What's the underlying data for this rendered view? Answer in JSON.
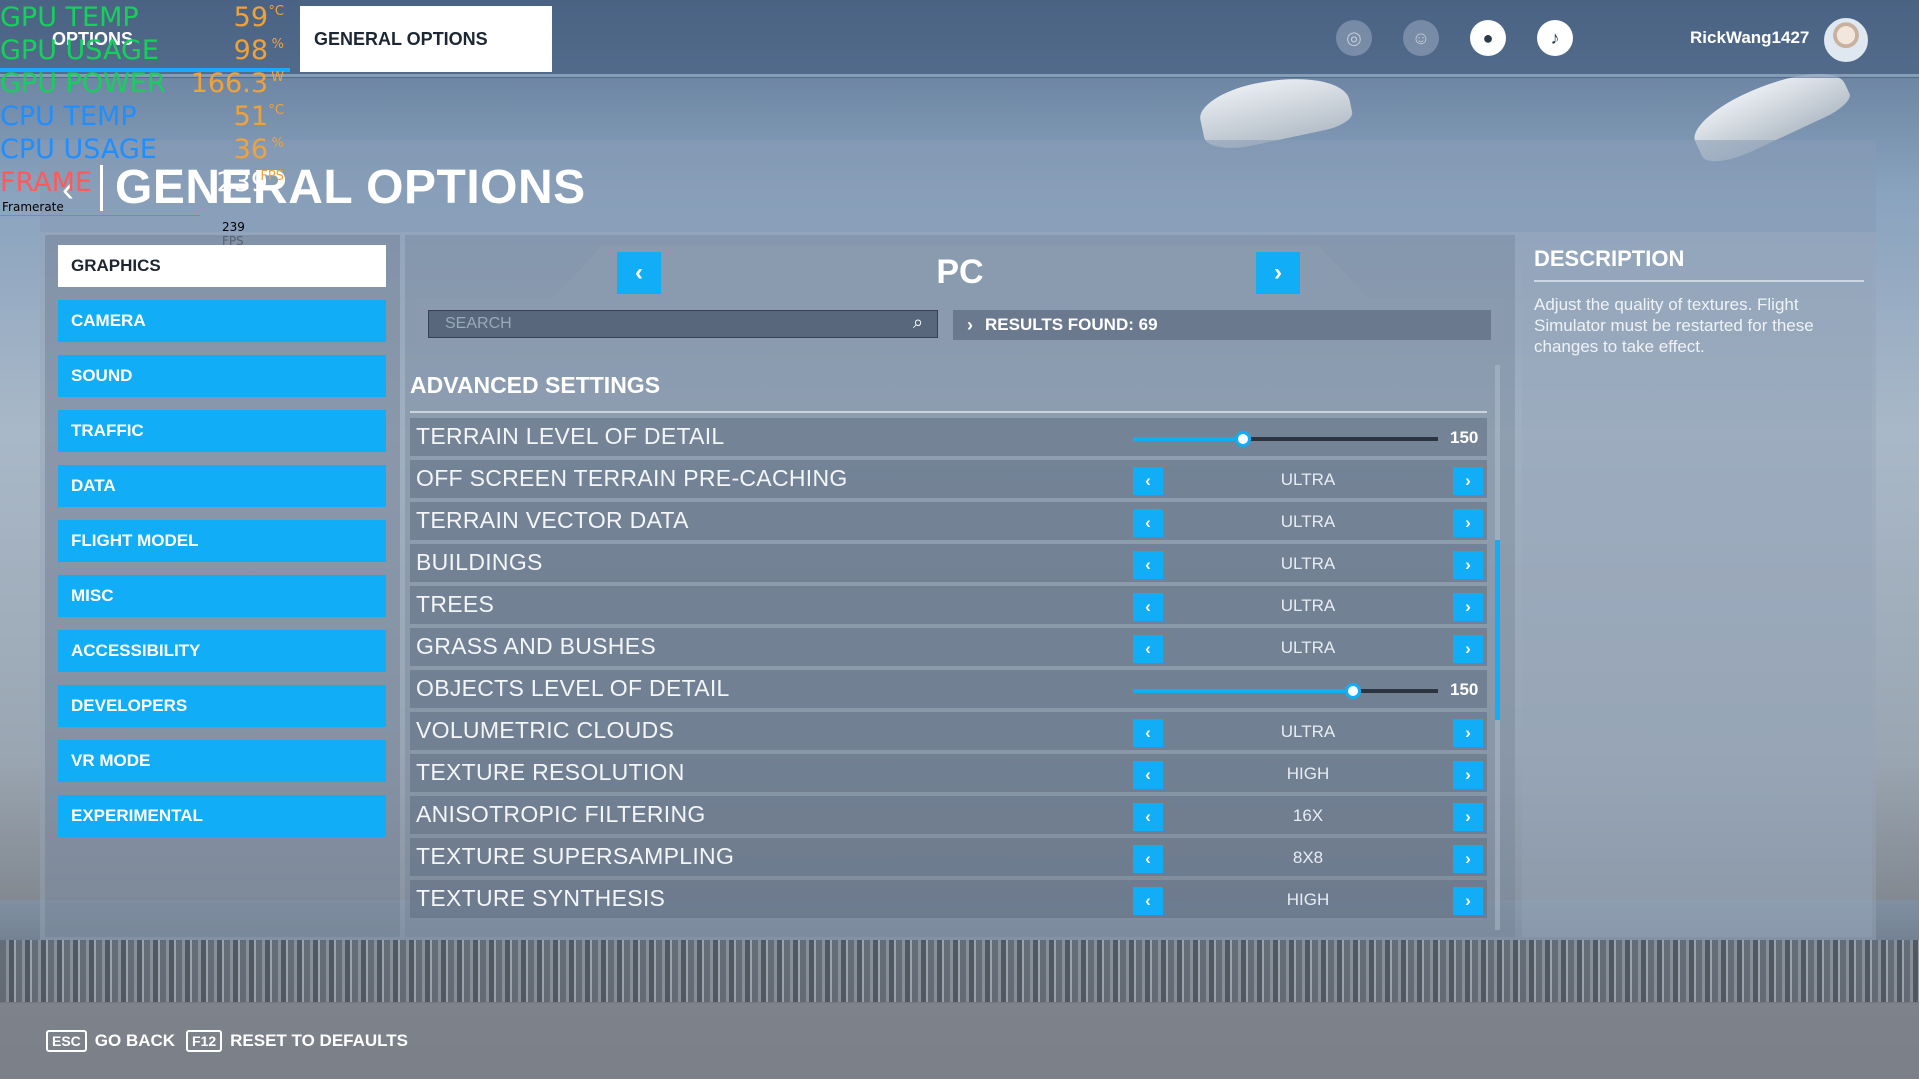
{
  "topbar": {
    "tabs": [
      {
        "label": "OPTIONS"
      },
      {
        "label": "GENERAL OPTIONS"
      }
    ],
    "username": "RickWang1427"
  },
  "hud": {
    "rows": [
      {
        "label": "GPU TEMP",
        "value": "59",
        "unit": "°C"
      },
      {
        "label": "GPU USAGE",
        "value": "98",
        "unit": "%"
      },
      {
        "label": "GPU POWER",
        "value": "166.3",
        "unit": "W"
      },
      {
        "label": "CPU TEMP",
        "value": "51",
        "unit": "°C"
      },
      {
        "label": "CPU USAGE",
        "value": "36",
        "unit": "%"
      },
      {
        "label": "FRAME",
        "value": "239",
        "unit": "FPS"
      }
    ],
    "graph_label": "Framerate",
    "graph_value": "239 FPS"
  },
  "page": {
    "title": "GENERAL OPTIONS"
  },
  "sidebar": {
    "items": [
      {
        "label": "GRAPHICS",
        "active": true
      },
      {
        "label": "CAMERA"
      },
      {
        "label": "SOUND"
      },
      {
        "label": "TRAFFIC"
      },
      {
        "label": "DATA"
      },
      {
        "label": "FLIGHT MODEL"
      },
      {
        "label": "MISC"
      },
      {
        "label": "ACCESSIBILITY"
      },
      {
        "label": "DEVELOPERS"
      },
      {
        "label": "VR MODE"
      },
      {
        "label": "EXPERIMENTAL"
      }
    ]
  },
  "platform": {
    "label": "PC"
  },
  "search": {
    "placeholder": "SEARCH",
    "results_label": "RESULTS FOUND: 69"
  },
  "section": {
    "title": "ADVANCED SETTINGS"
  },
  "settings": [
    {
      "label": "TERRAIN LEVEL OF DETAIL",
      "type": "slider",
      "value": "150",
      "fraction": 0.36
    },
    {
      "label": "OFF SCREEN TERRAIN PRE-CACHING",
      "type": "select",
      "value": "ULTRA"
    },
    {
      "label": "TERRAIN VECTOR DATA",
      "type": "select",
      "value": "ULTRA"
    },
    {
      "label": "BUILDINGS",
      "type": "select",
      "value": "ULTRA"
    },
    {
      "label": "TREES",
      "type": "select",
      "value": "ULTRA"
    },
    {
      "label": "GRASS AND BUSHES",
      "type": "select",
      "value": "ULTRA"
    },
    {
      "label": "OBJECTS LEVEL OF DETAIL",
      "type": "slider",
      "value": "150",
      "fraction": 0.72
    },
    {
      "label": "VOLUMETRIC CLOUDS",
      "type": "select",
      "value": "ULTRA"
    },
    {
      "label": "TEXTURE RESOLUTION",
      "type": "select",
      "value": "HIGH"
    },
    {
      "label": "ANISOTROPIC FILTERING",
      "type": "select",
      "value": "16X"
    },
    {
      "label": "TEXTURE SUPERSAMPLING",
      "type": "select",
      "value": "8X8"
    },
    {
      "label": "TEXTURE SYNTHESIS",
      "type": "select",
      "value": "HIGH"
    }
  ],
  "description": {
    "title": "DESCRIPTION",
    "text": "Adjust the quality of textures. Flight Simulator must be restarted for these changes to take effect."
  },
  "footer": {
    "back_key": "ESC",
    "back_label": "GO BACK",
    "reset_key": "F12",
    "reset_label": "RESET TO DEFAULTS"
  },
  "colors": {
    "accent": "#11aef7",
    "active_tab": "#ffffff"
  },
  "icons": {
    "top": [
      "achievements-icon",
      "friends-icon",
      "profile-icon",
      "notifications-icon"
    ]
  }
}
